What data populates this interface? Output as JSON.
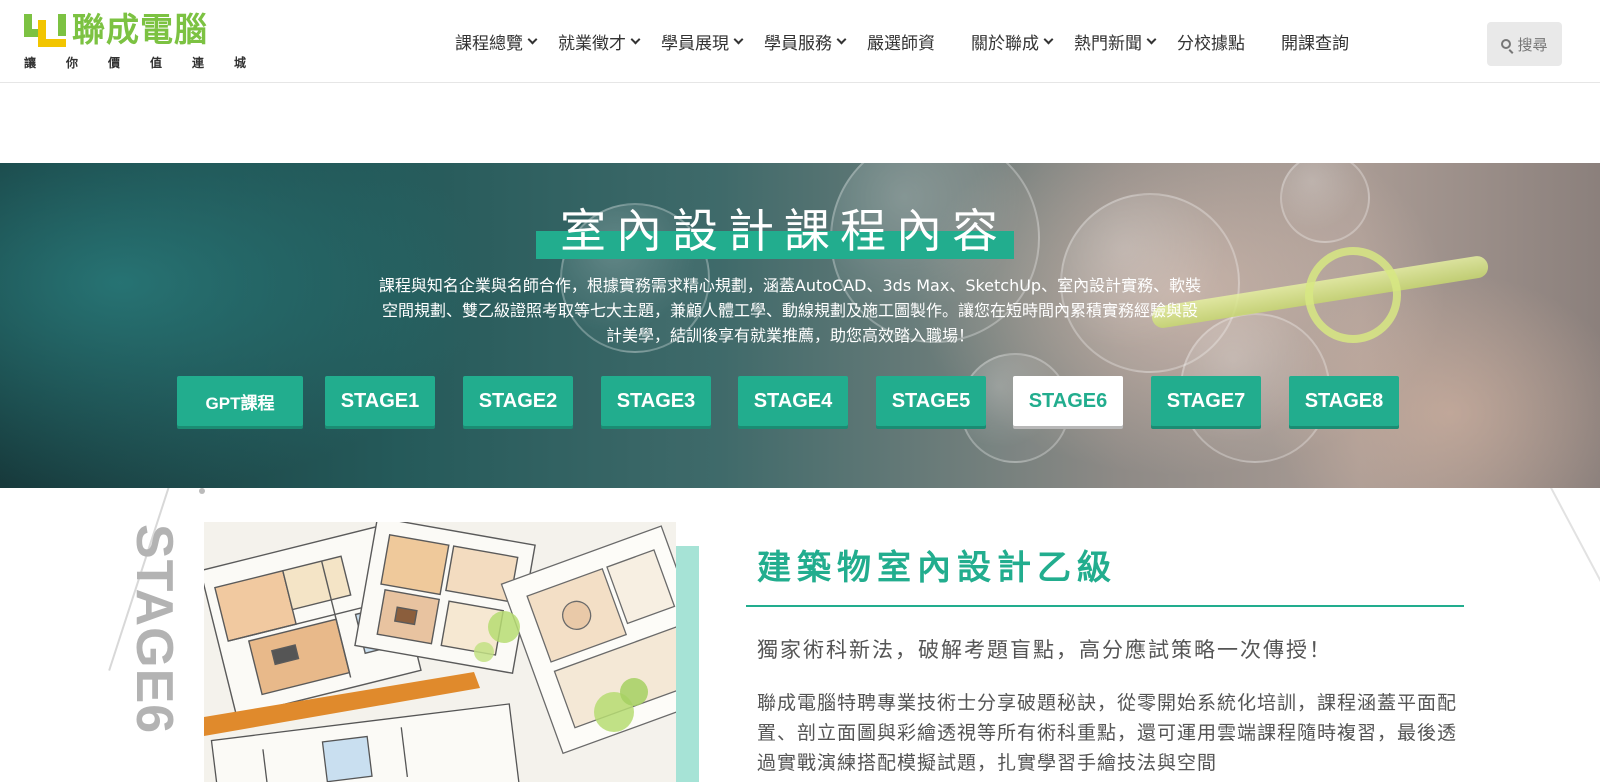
{
  "header": {
    "logo_text": "聯成電腦",
    "logo_slogan": "讓你價值連城",
    "nav": [
      {
        "label": "課程總覽",
        "has_dropdown": true
      },
      {
        "label": "就業徵才",
        "has_dropdown": true
      },
      {
        "label": "學員展現",
        "has_dropdown": true
      },
      {
        "label": "學員服務",
        "has_dropdown": true
      },
      {
        "label": "嚴選師資",
        "has_dropdown": false
      },
      {
        "label": "關於聯成",
        "has_dropdown": true
      },
      {
        "label": "熱門新聞",
        "has_dropdown": true
      },
      {
        "label": "分校據點",
        "has_dropdown": false
      },
      {
        "label": "開課查詢",
        "has_dropdown": false
      }
    ],
    "search_label": "搜尋"
  },
  "hero": {
    "title": "室內設計課程內容",
    "description": "課程與知名企業與名師合作，根據實務需求精心規劃，涵蓋AutoCAD、3ds Max、SketchUp、室內設計實務、軟裝空間規劃、雙乙級證照考取等七大主題，兼顧人體工學、動線規劃及施工圖製作。讓您在短時間內累積實務經驗與設計美學，結訓後享有就業推薦，助您高效踏入職場！",
    "stages": [
      {
        "label": "GPT課程",
        "active": false
      },
      {
        "label": "STAGE1",
        "active": false
      },
      {
        "label": "STAGE2",
        "active": false
      },
      {
        "label": "STAGE3",
        "active": false
      },
      {
        "label": "STAGE4",
        "active": false
      },
      {
        "label": "STAGE5",
        "active": false
      },
      {
        "label": "STAGE6",
        "active": true
      },
      {
        "label": "STAGE7",
        "active": false
      },
      {
        "label": "STAGE8",
        "active": false
      }
    ]
  },
  "section": {
    "stage_label": "STAGE6",
    "course_title": "建築物室內設計乙級",
    "subtitle": "獨家術科新法，破解考題盲點，高分應試策略一次傳授！",
    "body": "聯成電腦特聘專業技術士分享破題秘訣，從零開始系統化培訓，課程涵蓋平面配置、剖立面圖與彩繪透視等所有術科重點，還可運用雲端課程隨時複習，最後透過實戰演練搭配模擬試題，扎實學習手繪技法與空間"
  },
  "colors": {
    "brand_green": "#7cc242",
    "brand_yellow": "#f2c500",
    "accent_teal": "#22ad8e",
    "accent_teal_light": "#a6e3d6",
    "stage_text_gray": "#b3b3b3"
  },
  "icons": {
    "search": "search-icon",
    "nav_dropdown": "chevron-down-icon",
    "logo": "lc-logo-icon"
  }
}
